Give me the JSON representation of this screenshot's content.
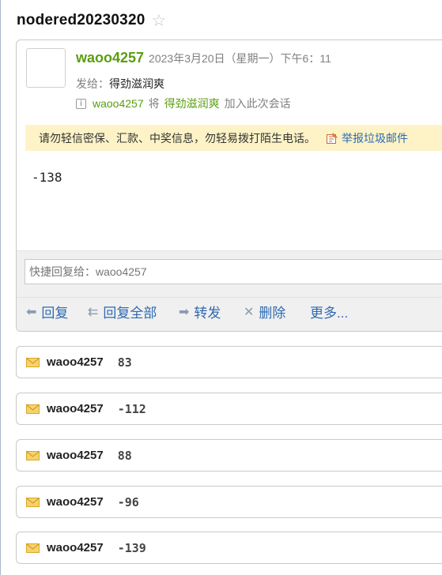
{
  "subject": "nodered20230320",
  "mail": {
    "sender": "waoo4257",
    "date": "2023年3月20日（星期一）下午6：11",
    "to_label": "发给：",
    "to_name": "得劲滋润爽",
    "info_user": "waoo4257",
    "info_jiang": "将",
    "info_contact": "得劲滋润爽",
    "info_add": "加入此次会话",
    "warning": "请勿轻信密保、汇款、中奖信息，勿轻易拨打陌生电话。",
    "report_label": "举报垃圾邮件",
    "body": "-138"
  },
  "reply": {
    "placeholder": "快捷回复给：waoo4257",
    "actions": {
      "reply": "回复",
      "reply_all": "回复全部",
      "forward": "转发",
      "delete": "删除",
      "more": "更多..."
    }
  },
  "thread": [
    {
      "sender": "waoo4257",
      "preview": "83"
    },
    {
      "sender": "waoo4257",
      "preview": "-112"
    },
    {
      "sender": "waoo4257",
      "preview": "88"
    },
    {
      "sender": "waoo4257",
      "preview": "-96"
    },
    {
      "sender": "waoo4257",
      "preview": "-139"
    }
  ],
  "colors": {
    "sender_green": "#5a9e0f",
    "link_blue": "#2e6ab1",
    "warning_bg": "#fdf3c6"
  }
}
